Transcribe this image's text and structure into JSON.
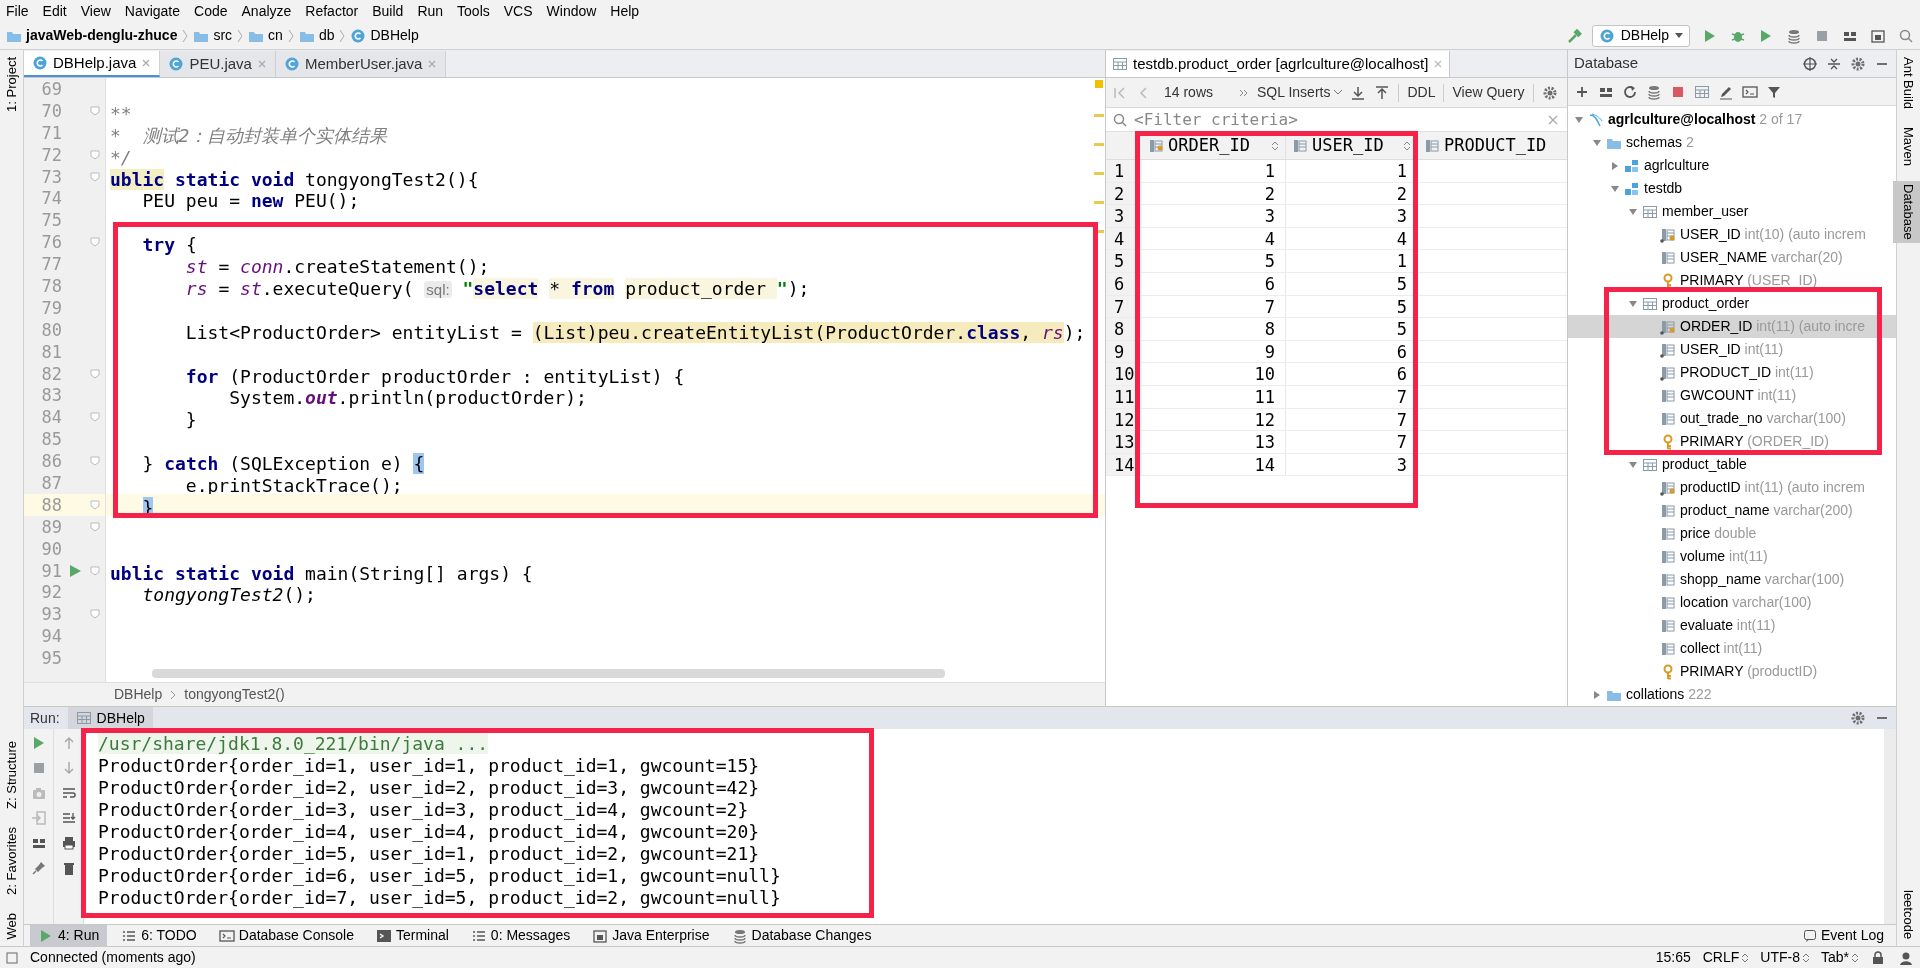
{
  "menu": [
    "File",
    "Edit",
    "View",
    "Navigate",
    "Code",
    "Analyze",
    "Refactor",
    "Build",
    "Run",
    "Tools",
    "VCS",
    "Window",
    "Help"
  ],
  "nav_path": [
    "javaWeb-denglu-zhuce",
    "src",
    "cn",
    "db",
    "DBHelp"
  ],
  "run_config": "DBHelp",
  "left_tool_tabs": [
    {
      "label": "1: Project",
      "selected": false
    },
    {
      "label": "Z: Structure",
      "selected": false
    },
    {
      "label": "2: Favorites",
      "selected": false
    },
    {
      "label": "Web",
      "selected": false
    }
  ],
  "right_tool_tabs": [
    {
      "label": "Ant Build",
      "selected": false
    },
    {
      "label": "Maven",
      "selected": false
    },
    {
      "label": "Database",
      "selected": true
    },
    {
      "label": "leetcode",
      "selected": false
    }
  ],
  "editor": {
    "tabs": [
      {
        "label": "DBHelp.java",
        "selected": true
      },
      {
        "label": "PEU.java",
        "selected": false
      },
      {
        "label": "MemberUser.java",
        "selected": false
      }
    ],
    "lines": [
      {
        "number": "69"
      },
      {
        "number": "70",
        "fold": true,
        "segments": [
          {
            "text": "**",
            "kind": "comment"
          }
        ]
      },
      {
        "number": "71",
        "segments": [
          {
            "text": "*  测试2：自动封装单个实体结果",
            "kind": "comment"
          }
        ]
      },
      {
        "number": "72",
        "fold": true,
        "segments": [
          {
            "text": "*/",
            "kind": "comment"
          }
        ]
      },
      {
        "number": "73",
        "fold": true,
        "segments": [
          {
            "text": "ublic",
            "kind": "keyword",
            "usage_highlight": true
          },
          {
            "text": " static void ",
            "kind": "keyword"
          },
          {
            "text": "tongyongTest2(){",
            "kind": "plain"
          }
        ]
      },
      {
        "number": "74",
        "segments": [
          {
            "text": "   PEU peu = ",
            "kind": "plain"
          },
          {
            "text": "new",
            "kind": "keyword"
          },
          {
            "text": " PEU();",
            "kind": "plain"
          }
        ]
      },
      {
        "number": "75"
      },
      {
        "number": "76",
        "fold": true,
        "segments": [
          {
            "text": "   try",
            "kind": "keyword"
          },
          {
            "text": " {",
            "kind": "plain"
          }
        ]
      },
      {
        "number": "77",
        "segments": [
          {
            "text": "       st",
            "kind": "field"
          },
          {
            "text": " = ",
            "kind": "plain"
          },
          {
            "text": "conn",
            "kind": "field"
          },
          {
            "text": ".createStatement();",
            "kind": "plain"
          }
        ]
      },
      {
        "number": "78",
        "segments": [
          {
            "text": "       rs",
            "kind": "field"
          },
          {
            "text": " = ",
            "kind": "plain"
          },
          {
            "text": "st",
            "kind": "field"
          },
          {
            "text": ".executeQuery( ",
            "kind": "plain"
          },
          {
            "text": "sql:",
            "kind": "hint"
          },
          {
            "text": " \"",
            "kind": "string"
          },
          {
            "text": "select",
            "kind": "sql_keyword",
            "injected": true
          },
          {
            "text": " * ",
            "kind": "sql",
            "injected": true
          },
          {
            "text": "from",
            "kind": "sql_keyword",
            "injected": true
          },
          {
            "text": " product_order ",
            "kind": "sql",
            "injected": true
          },
          {
            "text": "\"",
            "kind": "string"
          },
          {
            "text": ");",
            "kind": "plain"
          }
        ]
      },
      {
        "number": "79"
      },
      {
        "number": "80",
        "segments": [
          {
            "text": "       List<ProductOrder> entityList = ",
            "kind": "plain"
          },
          {
            "text": "(List)peu.createEntityList(ProductOrder.",
            "kind": "plain",
            "warning": true
          },
          {
            "text": "class",
            "kind": "keyword",
            "warning": true
          },
          {
            "text": ", ",
            "kind": "plain",
            "warning": true
          },
          {
            "text": "rs",
            "kind": "field",
            "warning": true
          },
          {
            "text": ");",
            "kind": "plain"
          }
        ]
      },
      {
        "number": "81"
      },
      {
        "number": "82",
        "fold": true,
        "segments": [
          {
            "text": "       for",
            "kind": "keyword"
          },
          {
            "text": " (ProductOrder productOrder : entityList) {",
            "kind": "plain"
          }
        ]
      },
      {
        "number": "83",
        "segments": [
          {
            "text": "           System.",
            "kind": "plain"
          },
          {
            "text": "out",
            "kind": "static_field"
          },
          {
            "text": ".println(productOrder);",
            "kind": "plain"
          }
        ]
      },
      {
        "number": "84",
        "fold": true,
        "segments": [
          {
            "text": "       }",
            "kind": "plain"
          }
        ]
      },
      {
        "number": "85"
      },
      {
        "number": "86",
        "fold": true,
        "segments": [
          {
            "text": "   } ",
            "kind": "plain"
          },
          {
            "text": "catch",
            "kind": "keyword"
          },
          {
            "text": " (SQLException e) ",
            "kind": "plain"
          },
          {
            "text": "{",
            "kind": "plain",
            "brace_match": true
          }
        ]
      },
      {
        "number": "87",
        "segments": [
          {
            "text": "       e.printStackTrace();",
            "kind": "plain"
          }
        ]
      },
      {
        "number": "88",
        "current": true,
        "fold": true,
        "segments": [
          {
            "text": "   }",
            "kind": "plain",
            "brace_match": true
          }
        ]
      },
      {
        "number": "89",
        "fold": true
      },
      {
        "number": "90"
      },
      {
        "number": "91",
        "fold": true,
        "run_marker": true,
        "segments": [
          {
            "text": "ublic static void ",
            "kind": "keyword"
          },
          {
            "text": "main(String[] args) {",
            "kind": "plain"
          }
        ]
      },
      {
        "number": "92",
        "segments": [
          {
            "text": "   tongyongTest2",
            "kind": "static_call"
          },
          {
            "text": "();",
            "kind": "plain"
          }
        ]
      },
      {
        "number": "93",
        "fold": true
      },
      {
        "number": "94"
      },
      {
        "number": "95"
      }
    ],
    "breadcrumb": [
      "DBHelp",
      "tongyongTest2()"
    ]
  },
  "result": {
    "tab": "testdb.product_order [agrlculture@localhost]",
    "row_count": "14 rows",
    "format": "SQL Inserts",
    "buttons": [
      "DDL",
      "View Query"
    ],
    "filter_placeholder": "<Filter criteria>",
    "columns": [
      "ORDER_ID",
      "USER_ID",
      "PRODUCT_ID"
    ],
    "rows": [
      {
        "number": "1",
        "cells": [
          "1",
          "1"
        ]
      },
      {
        "number": "2",
        "cells": [
          "2",
          "2"
        ]
      },
      {
        "number": "3",
        "cells": [
          "3",
          "3"
        ]
      },
      {
        "number": "4",
        "cells": [
          "4",
          "4"
        ]
      },
      {
        "number": "5",
        "cells": [
          "5",
          "1"
        ]
      },
      {
        "number": "6",
        "cells": [
          "6",
          "5"
        ]
      },
      {
        "number": "7",
        "cells": [
          "7",
          "5"
        ]
      },
      {
        "number": "8",
        "cells": [
          "8",
          "5"
        ]
      },
      {
        "number": "9",
        "cells": [
          "9",
          "6"
        ]
      },
      {
        "number": "10",
        "cells": [
          "10",
          "6"
        ]
      },
      {
        "number": "11",
        "cells": [
          "11",
          "7"
        ]
      },
      {
        "number": "12",
        "cells": [
          "12",
          "7"
        ]
      },
      {
        "number": "13",
        "cells": [
          "13",
          "7"
        ]
      },
      {
        "number": "14",
        "cells": [
          "14",
          "3"
        ]
      }
    ]
  },
  "database": {
    "title": "Database",
    "tree": [
      {
        "name": "agrlculture@localhost",
        "detail": "2 of 17",
        "kind": "connection",
        "expanded": true,
        "selected": false,
        "children": [
          {
            "name": "schemas",
            "detail": "2",
            "kind": "folder",
            "expanded": true,
            "selected": false,
            "children": [
              {
                "name": "agrlculture",
                "kind": "schema",
                "expanded": false,
                "selected": false
              },
              {
                "name": "testdb",
                "kind": "schema",
                "expanded": true,
                "selected": false,
                "children": [
                  {
                    "name": "member_user",
                    "kind": "table",
                    "expanded": true,
                    "selected": false,
                    "children": [
                      {
                        "name": "USER_ID",
                        "detail": "int(10) (auto increm",
                        "kind": "key_column",
                        "selected": false
                      },
                      {
                        "name": "USER_NAME",
                        "detail": "varchar(20)",
                        "kind": "column",
                        "selected": false
                      },
                      {
                        "name": "PRIMARY",
                        "detail": "(USER_ID)",
                        "kind": "key",
                        "selected": false
                      }
                    ]
                  },
                  {
                    "name": "product_order",
                    "kind": "table",
                    "expanded": true,
                    "selected": false,
                    "children": [
                      {
                        "name": "ORDER_ID",
                        "detail": "int(11) (auto incre",
                        "kind": "key_column",
                        "selected": true
                      },
                      {
                        "name": "USER_ID",
                        "detail": "int(11)",
                        "kind": "ref_column",
                        "selected": false
                      },
                      {
                        "name": "PRODUCT_ID",
                        "detail": "int(11)",
                        "kind": "ref_column",
                        "selected": false
                      },
                      {
                        "name": "GWCOUNT",
                        "detail": "int(11)",
                        "kind": "column",
                        "selected": false
                      },
                      {
                        "name": "out_trade_no",
                        "detail": "varchar(100)",
                        "kind": "column",
                        "selected": false
                      },
                      {
                        "name": "PRIMARY",
                        "detail": "(ORDER_ID)",
                        "kind": "key",
                        "selected": false
                      }
                    ]
                  },
                  {
                    "name": "product_table",
                    "kind": "table",
                    "expanded": true,
                    "selected": false,
                    "children": [
                      {
                        "name": "productID",
                        "detail": "int(11) (auto increm",
                        "kind": "key_column",
                        "selected": false
                      },
                      {
                        "name": "product_name",
                        "detail": "varchar(200)",
                        "kind": "column",
                        "selected": false
                      },
                      {
                        "name": "price",
                        "detail": "double",
                        "kind": "column",
                        "selected": false
                      },
                      {
                        "name": "volume",
                        "detail": "int(11)",
                        "kind": "column",
                        "selected": false
                      },
                      {
                        "name": "shopp_name",
                        "detail": "varchar(100)",
                        "kind": "column",
                        "selected": false
                      },
                      {
                        "name": "location",
                        "detail": "varchar(100)",
                        "kind": "column",
                        "selected": false
                      },
                      {
                        "name": "evaluate",
                        "detail": "int(11)",
                        "kind": "column",
                        "selected": false
                      },
                      {
                        "name": "collect",
                        "detail": "int(11)",
                        "kind": "column",
                        "selected": false
                      },
                      {
                        "name": "PRIMARY",
                        "detail": "(productID)",
                        "kind": "key",
                        "selected": false
                      }
                    ]
                  }
                ]
              }
            ]
          },
          {
            "name": "collations",
            "detail": "222",
            "kind": "folder",
            "expanded": false,
            "selected": false
          }
        ]
      }
    ]
  },
  "run": {
    "label": "Run:",
    "tab": "DBHelp",
    "output": [
      {
        "text": "/usr/share/jdk1.8.0_221/bin/java ...",
        "kind": "command"
      },
      {
        "text": "ProductOrder{order_id=1, user_id=1, product_id=1, gwcount=15}",
        "kind": "stdout"
      },
      {
        "text": "ProductOrder{order_id=2, user_id=2, product_id=3, gwcount=42}",
        "kind": "stdout"
      },
      {
        "text": "ProductOrder{order_id=3, user_id=3, product_id=4, gwcount=2}",
        "kind": "stdout"
      },
      {
        "text": "ProductOrder{order_id=4, user_id=4, product_id=4, gwcount=20}",
        "kind": "stdout"
      },
      {
        "text": "ProductOrder{order_id=5, user_id=1, product_id=2, gwcount=21}",
        "kind": "stdout"
      },
      {
        "text": "ProductOrder{order_id=6, user_id=5, product_id=1, gwcount=null}",
        "kind": "stdout"
      },
      {
        "text": "ProductOrder{order_id=7, user_id=5, product_id=2, gwcount=null}",
        "kind": "stdout"
      }
    ]
  },
  "tool_windows": [
    {
      "label": "4: Run",
      "selected": true
    },
    {
      "label": "6: TODO",
      "selected": false
    },
    {
      "label": "Database Console",
      "selected": false
    },
    {
      "label": "Terminal",
      "selected": false
    },
    {
      "label": "0: Messages",
      "selected": false
    },
    {
      "label": "Java Enterprise",
      "selected": false
    },
    {
      "label": "Database Changes",
      "selected": false
    }
  ],
  "event_log": "Event Log",
  "status": {
    "message": "Connected (moments ago)",
    "position": "15:65",
    "line_separator": "CRLF",
    "encoding": "UTF-8",
    "indent": "Tab*"
  },
  "highlights": [
    {
      "kind": "editor"
    },
    {
      "kind": "result_table"
    },
    {
      "kind": "tree_node"
    },
    {
      "kind": "console"
    }
  ]
}
